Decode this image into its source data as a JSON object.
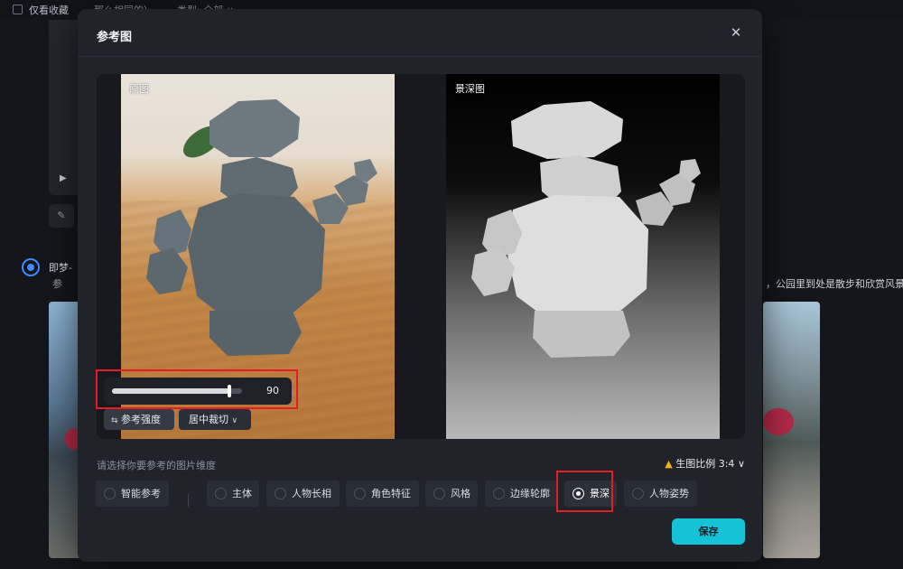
{
  "background": {
    "top_checkbox_label": "仅看收藏",
    "top_filter_1": "那么相同的）",
    "top_filter_2": "类型: 全部 ∨",
    "play_icon": "play-icon",
    "edit_icon": "pencil-icon",
    "author_name": "即梦-",
    "author_sub": "参",
    "description": "，公园里到处是散步和欣赏风景的"
  },
  "modal": {
    "title": "参考图",
    "close_icon": "close-icon",
    "close_glyph": "✕",
    "original_label": "原图",
    "depth_label": "景深图",
    "strength": {
      "value": 90,
      "value_label": "90",
      "max": 100
    },
    "buttons": {
      "strength_label": "参考强度",
      "strength_icon": "⇆",
      "crop_label": "居中裁切",
      "crop_icon": "∨"
    },
    "dimension_prompt": "请选择你要参考的图片维度",
    "ratio_label": "生图比例 3:4",
    "ratio_warn_icon": "▲",
    "ratio_chevron": "∨",
    "options": [
      {
        "label": "智能参考",
        "selected": false
      },
      {
        "label": "主体",
        "selected": false
      },
      {
        "label": "人物长相",
        "selected": false
      },
      {
        "label": "角色特征",
        "selected": false
      },
      {
        "label": "风格",
        "selected": false
      },
      {
        "label": "边缘轮廓",
        "selected": false
      },
      {
        "label": "景深",
        "selected": true
      },
      {
        "label": "人物姿势",
        "selected": false
      }
    ],
    "save_label": "保存"
  },
  "colors": {
    "accent": "#16c2d6",
    "annotation": "#e51c23",
    "warning": "#f2b01e"
  }
}
